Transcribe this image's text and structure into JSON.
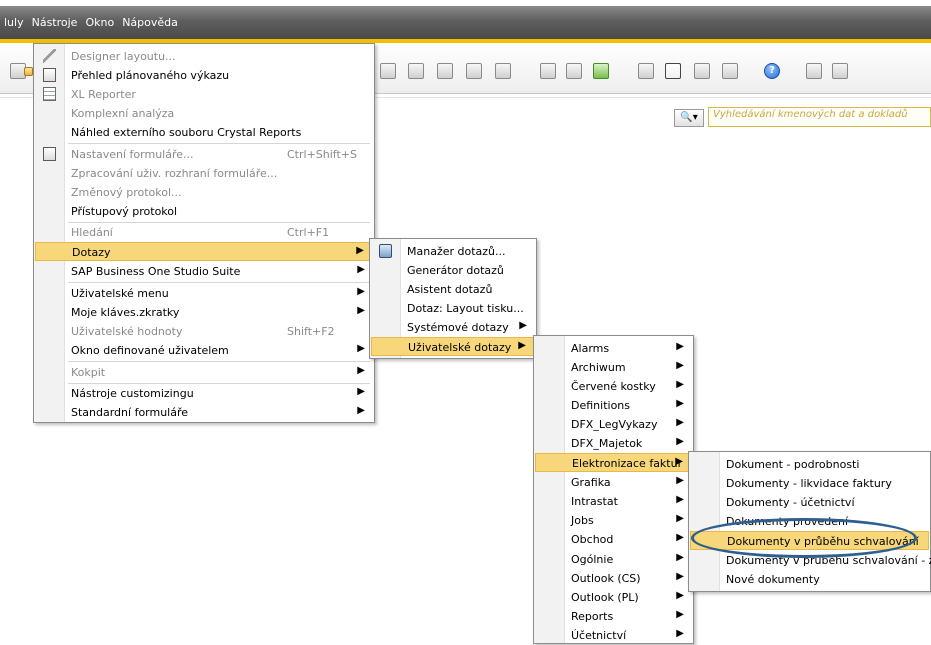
{
  "menubar": {
    "items": [
      "luly",
      "Nástroje",
      "Okno",
      "Nápověda"
    ]
  },
  "search": {
    "placeholder": "Vyhledávání kmenových dat a dokladů"
  },
  "tools_menu": {
    "items": [
      {
        "label": "Designer layoutu...",
        "disabled": true,
        "icon": "pen-icon"
      },
      {
        "label": "Přehled plánovaného výkazu",
        "icon": "report-icon"
      },
      {
        "label": "XL Reporter",
        "disabled": true,
        "icon": "xl-reporter-icon"
      },
      {
        "label": "Komplexní analýza",
        "disabled": true
      },
      {
        "label": "Náhled externího souboru Crystal Reports"
      },
      {
        "label": "Nastavení formuláře...",
        "shortcut": "Ctrl+Shift+S",
        "disabled": true,
        "icon": "form-settings-icon"
      },
      {
        "label": "Zpracování uživ. rozhraní formuláře...",
        "disabled": true
      },
      {
        "label": "Změnový protokol...",
        "disabled": true
      },
      {
        "label": "Přístupový protokol"
      },
      {
        "label": "Hledání",
        "shortcut": "Ctrl+F1",
        "disabled": true
      },
      {
        "label": "Dotazy",
        "submenu": true,
        "highlighted": true
      },
      {
        "label": "SAP Business One Studio Suite",
        "submenu": true
      },
      {
        "label": "Uživatelské menu",
        "submenu": true
      },
      {
        "label": "Moje kláves.zkratky",
        "submenu": true
      },
      {
        "label": "Uživatelské hodnoty",
        "shortcut": "Shift+F2",
        "disabled": true
      },
      {
        "label": "Okno definované uživatelem",
        "submenu": true
      },
      {
        "label": "Kokpit",
        "submenu": true,
        "disabled": true
      },
      {
        "label": "Nástroje customizingu",
        "submenu": true
      },
      {
        "label": "Standardní formuláře",
        "submenu": true
      }
    ]
  },
  "queries_menu": {
    "items": [
      {
        "label": "Manažer dotazů...",
        "icon": "query-manager-icon"
      },
      {
        "label": "Generátor dotazů"
      },
      {
        "label": "Asistent dotazů"
      },
      {
        "label": "Dotaz: Layout tisku..."
      },
      {
        "label": "Systémové dotazy",
        "submenu": true
      },
      {
        "label": "Uživatelské dotazy",
        "submenu": true,
        "highlighted": true
      }
    ]
  },
  "user_queries_menu": {
    "items": [
      {
        "label": "Alarms"
      },
      {
        "label": "Archiwum"
      },
      {
        "label": "Červené kostky"
      },
      {
        "label": "Definitions"
      },
      {
        "label": "DFX_LegVykazy"
      },
      {
        "label": "DFX_Majetok"
      },
      {
        "label": "Elektronizace faktur",
        "highlighted": true
      },
      {
        "label": "Grafika"
      },
      {
        "label": "Intrastat"
      },
      {
        "label": "Jobs"
      },
      {
        "label": "Obchod"
      },
      {
        "label": "Ogólnie"
      },
      {
        "label": "Outlook (CS)"
      },
      {
        "label": "Outlook (PL)"
      },
      {
        "label": "Reports"
      },
      {
        "label": "Účetnictví"
      }
    ]
  },
  "einvoice_menu": {
    "items": [
      {
        "label": "Dokument - podrobnosti"
      },
      {
        "label": "Dokumenty - likvidace faktury"
      },
      {
        "label": "Dokumenty - účetnictví"
      },
      {
        "label": "Dokumenty provedení"
      },
      {
        "label": "Dokumenty v průběhu schvalování",
        "highlighted": true
      },
      {
        "label": "Dokumenty v průběhu schvalování - zboží"
      },
      {
        "label": "Nové dokumenty"
      }
    ]
  },
  "colors": {
    "menu_highlight": "#f7d77a",
    "annotation_ellipse": "#2e5f8e",
    "title_bar": "#5e5e5e",
    "accent": "#f0c000"
  }
}
